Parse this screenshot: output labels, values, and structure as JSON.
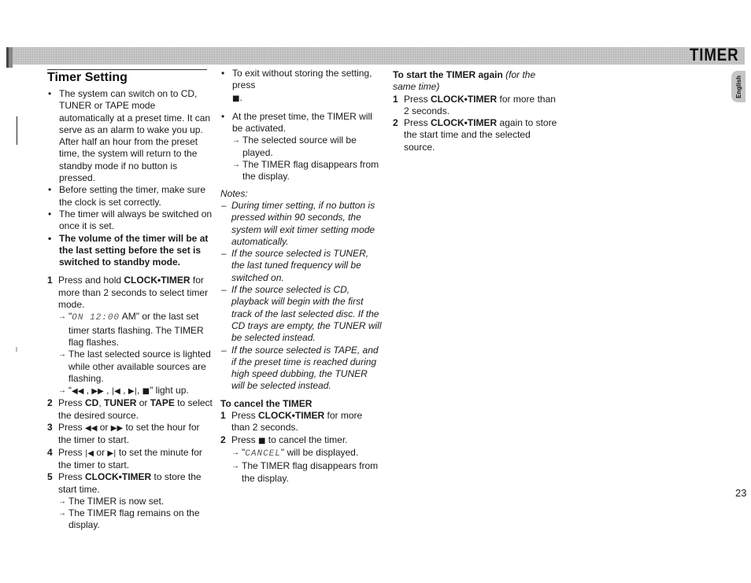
{
  "header": {
    "banner_title": "TIMER",
    "language_tab": "English",
    "page_number": "23"
  },
  "icons": {
    "stop": "■",
    "rewind": "◀◀",
    "fast_forward": "▶▶",
    "prev": "|◀",
    "next": "▶|"
  },
  "timer_setting": {
    "title": "Timer Setting",
    "bullets": [
      "The system can switch on to CD, TUNER or TAPE mode automatically at a preset time. It can serve as an alarm to wake you up. After half an hour from the preset time, the system will return to the standby mode if no button is pressed.",
      "Before setting the timer, make sure the clock is set correctly.",
      "The timer will always be switched on once it is set.",
      "The volume of the timer will be at the last setting before the set is switched to standby mode."
    ],
    "steps": [
      {
        "number": "1",
        "pre": "Press and hold ",
        "key": "CLOCK•TIMER",
        "post": " for more than 2 seconds to select timer mode.",
        "results": {
          "r1_pre": "\"",
          "r1_lcd": "ON  12:00",
          "r1_post": " AM\" or the last set timer starts flashing. The TIMER flag flashes.",
          "r2": "The last selected source is lighted while other available sources are flashing.",
          "r3_post": "\" light up."
        }
      },
      {
        "number": "2",
        "pre": "Press ",
        "key1": "CD",
        "sep1": ", ",
        "key2": "TUNER",
        "sep2": " or ",
        "key3": "TAPE",
        "post": " to select the desired source."
      },
      {
        "number": "3",
        "pre": "Press ",
        "mid": " or ",
        "post": " to set the hour for the timer to start."
      },
      {
        "number": "4",
        "pre": "Press ",
        "mid": " or ",
        "post": " to set the minute for the timer to start."
      },
      {
        "number": "5",
        "pre": "Press ",
        "key": "CLOCK•TIMER",
        "post": " to store the start time.",
        "results": [
          "The TIMER is now set.",
          "The TIMER flag remains on the display."
        ]
      }
    ]
  },
  "column2": {
    "exit_bullet_pre": "To exit without storing the setting, press",
    "exit_bullet_post": ".",
    "activated_bullet": "At the preset time, the TIMER will be activated.",
    "activated_results": [
      "The selected source will be played.",
      "The TIMER flag disappears from the display."
    ],
    "notes_label": "Notes:",
    "notes": [
      "During timer setting,  if no button is pressed within 90 seconds, the system will exit timer setting mode automatically.",
      "If the source selected is TUNER, the last tuned frequency will be switched on.",
      "If the source selected is CD, playback will begin with the first track of the last selected disc. If the CD trays are empty, the TUNER will be selected instead.",
      "If the source selected is TAPE, and if the preset time is reached during high speed dubbing, the TUNER will be selected instead."
    ],
    "cancel": {
      "title": "To cancel the TIMER",
      "step1_pre": "Press ",
      "step1_key": "CLOCK•TIMER",
      "step1_post": " for more than 2 seconds.",
      "step2_pre": "Press ",
      "step2_post": "  to cancel the timer.",
      "result1_pre": "\"",
      "result1_lcd": "CANCEL",
      "result1_post": "\" will be displayed.",
      "result2": "The TIMER flag disappears from the display."
    }
  },
  "column3": {
    "title": "To start the TIMER again",
    "title_note": "(for the same time)",
    "step1_pre": "Press ",
    "step1_key": "CLOCK•TIMER",
    "step1_post": " for more than 2 seconds.",
    "step2_pre": "Press ",
    "step2_key": "CLOCK•TIMER",
    "step2_post": " again to store the start time and the selected source."
  }
}
